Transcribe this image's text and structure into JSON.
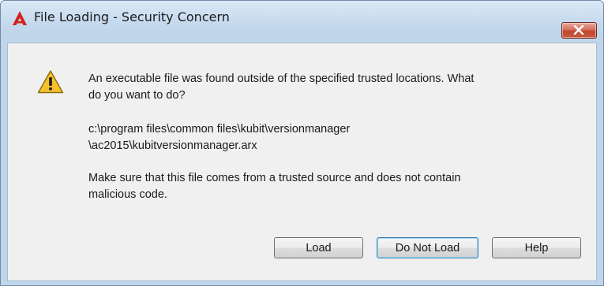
{
  "window": {
    "title": "File Loading - Security Concern",
    "app_icon": "autocad-a-icon",
    "close_icon": "close-x-icon"
  },
  "message": {
    "icon": "warning-triangle-icon",
    "line1": [
      "An executable file was found outside of the specified trusted locations.  What",
      "do you want to do?"
    ],
    "path": [
      "c:\\program files\\common files\\kubit\\versionmanager",
      "\\ac2015\\kubitversionmanager.arx"
    ],
    "advice": [
      "Make sure that this file comes from a trusted source and does not contain",
      "malicious code."
    ]
  },
  "buttons": {
    "load": "Load",
    "do_not_load": "Do Not Load",
    "help": "Help"
  },
  "colors": {
    "title_bar": "#c9dcef",
    "client_bg": "#f0f0f0",
    "close_button": "#c7503a",
    "warning_fill": "#f6c12c",
    "app_icon_red": "#d4221c",
    "default_button_border": "#3c7fb1"
  }
}
